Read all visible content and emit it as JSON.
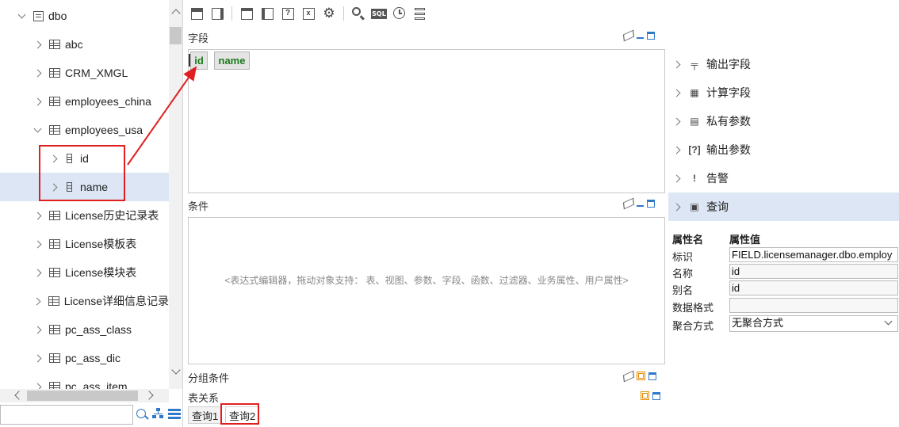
{
  "tree": {
    "items": [
      {
        "label": "dbo",
        "level": 0,
        "expanded": true,
        "icon": "database-icon"
      },
      {
        "label": "abc",
        "level": 1,
        "icon": "table-icon"
      },
      {
        "label": "CRM_XMGL",
        "level": 1,
        "icon": "table-icon"
      },
      {
        "label": "employees_china",
        "level": 1,
        "icon": "table-icon"
      },
      {
        "label": "employees_usa",
        "level": 1,
        "expanded": true,
        "icon": "table-icon"
      },
      {
        "label": "id",
        "level": 2,
        "icon": "field-icon"
      },
      {
        "label": "name",
        "level": 2,
        "icon": "field-icon",
        "selected": true
      },
      {
        "label": "License历史记录表",
        "level": 1,
        "icon": "table-icon"
      },
      {
        "label": "License模板表",
        "level": 1,
        "icon": "table-icon"
      },
      {
        "label": "License模块表",
        "level": 1,
        "icon": "table-icon"
      },
      {
        "label": "License详细信息记录",
        "level": 1,
        "icon": "table-icon"
      },
      {
        "label": "pc_ass_class",
        "level": 1,
        "icon": "table-icon"
      },
      {
        "label": "pc_ass_dic",
        "level": 1,
        "icon": "table-icon"
      },
      {
        "label": "pc_ass_item",
        "level": 1,
        "icon": "table-icon"
      }
    ],
    "search_value": ""
  },
  "sections": {
    "fields_title": "字段",
    "conditions_title": "条件",
    "group_title": "分组条件",
    "relations_title": "表关系"
  },
  "field_chips": [
    "id",
    "name"
  ],
  "conditions_hint": "<表达式编辑器，拖动对象支持： 表、视图、参数、字段、函数、过滤器、业务属性、用户属性>",
  "bottom_tabs": [
    "查询1",
    "查询2"
  ],
  "right_panel": {
    "items": [
      {
        "label": "输出字段",
        "icon": "output-field-icon",
        "glyph": "╤"
      },
      {
        "label": "计算字段",
        "icon": "calculator-icon",
        "glyph": "▦"
      },
      {
        "label": "私有参数",
        "icon": "private-param-icon",
        "glyph": "▤"
      },
      {
        "label": "输出参数",
        "icon": "output-param-icon",
        "glyph": "[?]"
      },
      {
        "label": "告警",
        "icon": "alert-icon",
        "glyph": "!"
      },
      {
        "label": "查询",
        "icon": "query-icon",
        "glyph": "▣",
        "selected": true
      }
    ]
  },
  "properties": {
    "header_name": "属性名",
    "header_value": "属性值",
    "rows": [
      {
        "name": "标识",
        "value": "FIELD.licensemanager.dbo.employ"
      },
      {
        "name": "名称",
        "value": "id"
      },
      {
        "name": "别名",
        "value": "id"
      },
      {
        "name": "数据格式",
        "value": ""
      },
      {
        "name": "聚合方式",
        "value": "无聚合方式"
      }
    ]
  },
  "toolbar": {
    "sql_label": "SQL"
  },
  "colors": {
    "accent": "#2f79c9",
    "selection": "#dce6f4",
    "annotation": "#e02020",
    "chip_text": "#1a7a1a"
  }
}
